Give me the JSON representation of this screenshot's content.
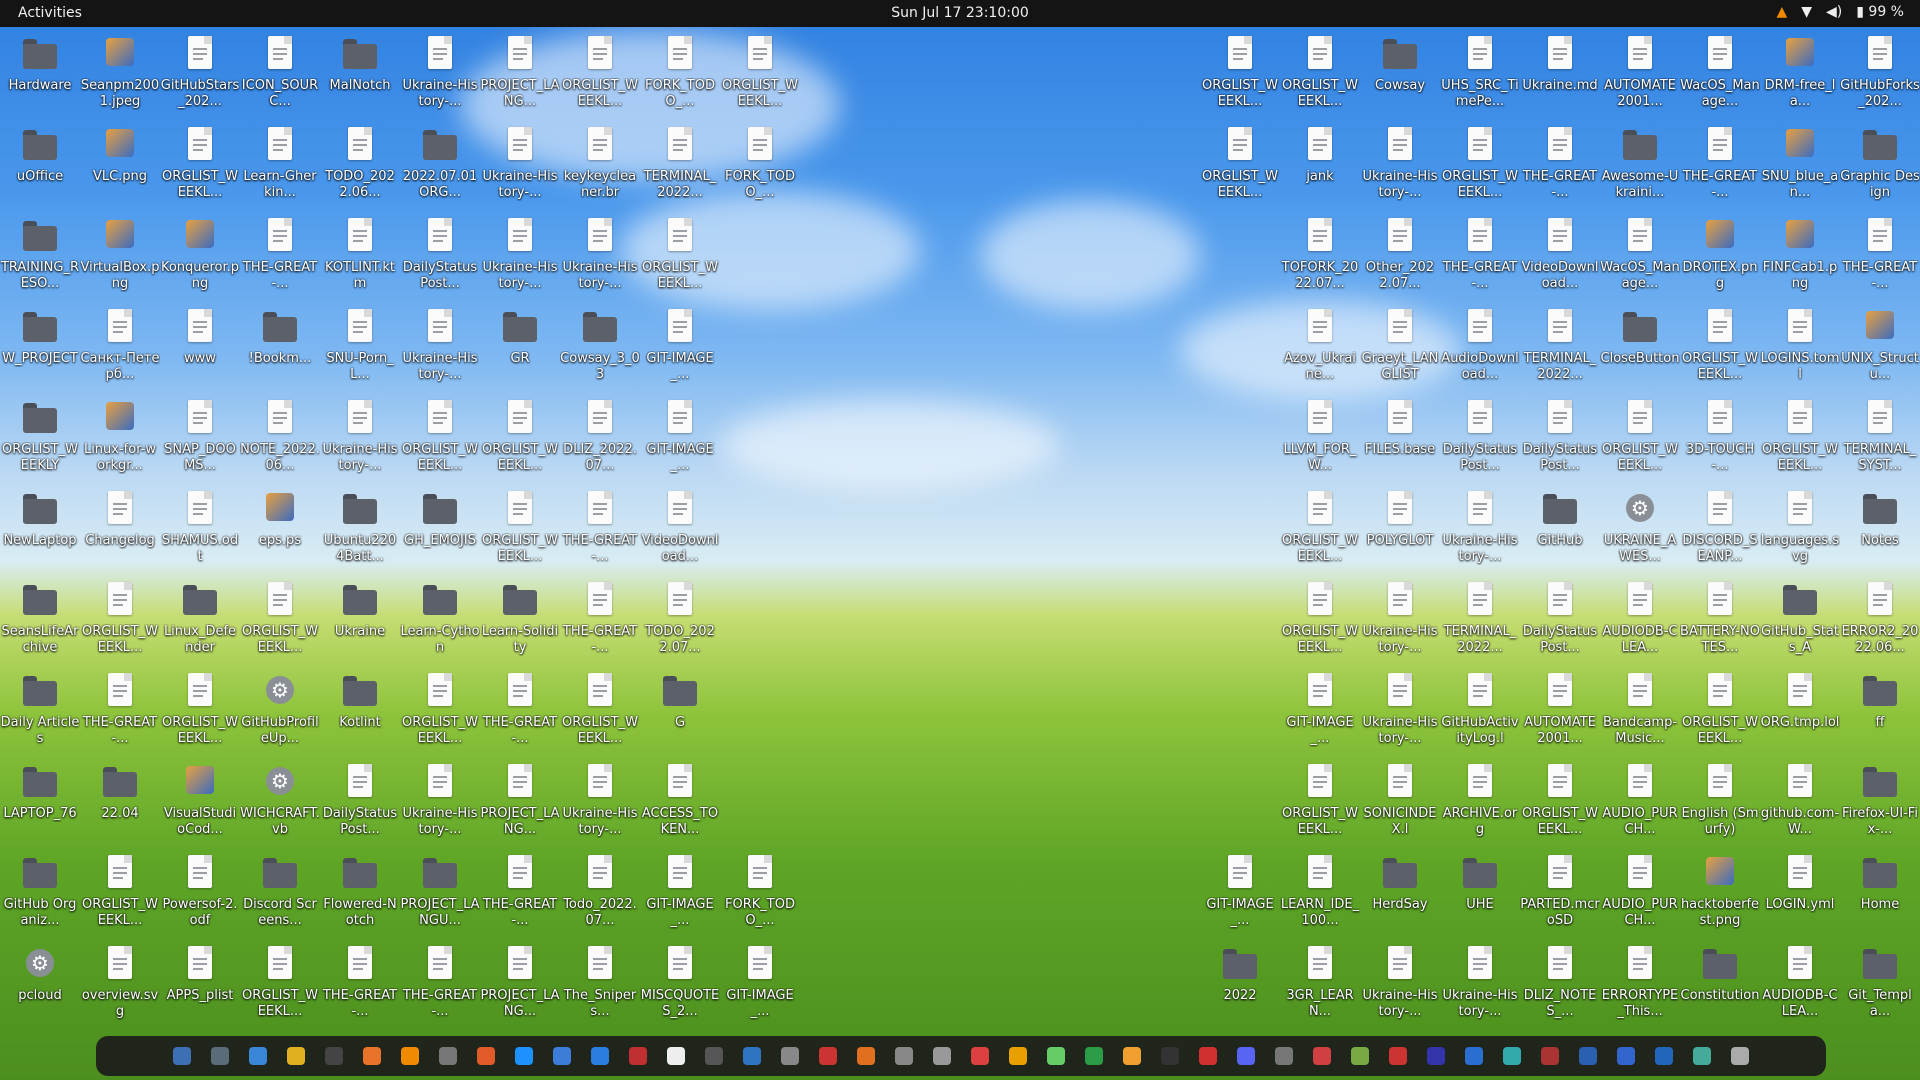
{
  "topbar": {
    "activities": "Activities",
    "clock": "Sun Jul 17  23:10:00",
    "tray": [
      {
        "icon": "vlc-cone-icon",
        "label": ""
      },
      {
        "icon": "wifi-icon",
        "label": ""
      },
      {
        "icon": "volume-icon",
        "label": ""
      },
      {
        "icon": "battery-icon",
        "label": "99 %"
      }
    ]
  },
  "desktop_left": [
    [
      "Hardware",
      "Seanpm2001.jpeg",
      "GitHubStars_202...",
      "ICON_SOURC...",
      "MalNotch",
      "Ukraine-History-...",
      "PROJECT_LANG...",
      "ORGLIST_WEEKL...",
      "FORK_TODO_...",
      "ORGLIST_WEEKL..."
    ],
    [
      "uOffice",
      "VLC.png",
      "ORGLIST_WEEKL...",
      "Learn-Gherkin...",
      "TODO_2022.06...",
      "2022.07.01ORG...",
      "Ukraine-History-...",
      "keykeycleaner.br",
      "TERMINAL_2022...",
      "FORK_TODO_..."
    ],
    [
      "TRAINING_RESO...",
      "VirtualBox.png",
      "Konqueror.png",
      "THE-GREAT-...",
      "KOTLINT.ktm",
      "DailyStatusPost...",
      "Ukraine-History-...",
      "Ukraine-History-...",
      "ORGLIST_WEEKL..."
    ],
    [
      "W_PROJECT",
      "Санкт-Петерб...",
      "www",
      "!Bookm...",
      "SNU-Porn_L...",
      "Ukraine-History-...",
      "GR",
      "Cowsay_3_03",
      "GIT-IMAGE_..."
    ],
    [
      "ORGLIST_WEEKLY",
      "Linux-for-workgr...",
      "SNAP_DOOMS...",
      "NOTE_2022.06...",
      "Ukraine-History-...",
      "ORGLIST_WEEKL...",
      "ORGLIST_WEEKL...",
      "DLIZ_2022.07...",
      "GIT-IMAGE_..."
    ],
    [
      "NewLaptop",
      "Changelog",
      "SHAMUS.odt",
      "eps.ps",
      "Ubuntu2204Batt...",
      "GH_EMOJIS",
      "ORGLIST_WEEKL...",
      "THE-GREAT-...",
      "VideoDownload..."
    ],
    [
      "SeansLifeArchive",
      "ORGLIST_WEEKL...",
      "Linux_Defender",
      "ORGLIST_WEEKL...",
      "Ukraine",
      "Learn-Cython",
      "Learn-Solidity",
      "THE-GREAT-...",
      "TODO_2022.07..."
    ],
    [
      "Daily Articles",
      "THE-GREAT-...",
      "ORGLIST_WEEKL...",
      "GitHubProfileUp...",
      "Kotlint",
      "ORGLIST_WEEKL...",
      "THE-GREAT-...",
      "ORGLIST_WEEKL...",
      "G"
    ],
    [
      "LAPTOP_76",
      "22.04",
      "VisualStudioCod...",
      "WICHCRAFT.vb",
      "DailyStatusPost...",
      "Ukraine-History-...",
      "PROJECT_LANG...",
      "Ukraine-History-...",
      "ACCESS_TOKEN..."
    ],
    [
      "GitHub Organiz...",
      "ORGLIST_WEEKL...",
      "Powersof-2.odf",
      "Discord Screens...",
      "Flowered-Notch",
      "PROJECT_LANGU...",
      "THE-GREAT-...",
      "Todo_2022.07...",
      "GIT-IMAGE_...",
      "FORK_TODO_..."
    ],
    [
      "pcloud",
      "overview.svg",
      "APPS_plist",
      "ORGLIST_WEEKL...",
      "THE-GREAT-...",
      "THE-GREAT-...",
      "PROJECT_LANG...",
      "The_Snipers...",
      "MISCQUOTES_2...",
      "GIT-IMAGE_..."
    ]
  ],
  "desktop_left_kinds": [
    [
      "folder",
      "img",
      "file",
      "file",
      "folder",
      "file",
      "file",
      "file",
      "file",
      "file"
    ],
    [
      "folder",
      "img",
      "file",
      "file",
      "file",
      "folder",
      "file",
      "file",
      "file",
      "file"
    ],
    [
      "folder",
      "img",
      "img",
      "file",
      "file",
      "file",
      "file",
      "file",
      "file"
    ],
    [
      "folder",
      "file",
      "file",
      "folder",
      "file",
      "file",
      "folder",
      "folder",
      "file"
    ],
    [
      "folder",
      "img",
      "file",
      "file",
      "file",
      "file",
      "file",
      "file",
      "file"
    ],
    [
      "folder",
      "file",
      "file",
      "img",
      "folder",
      "folder",
      "file",
      "file",
      "file"
    ],
    [
      "folder",
      "file",
      "folder",
      "file",
      "folder",
      "folder",
      "folder",
      "file",
      "file"
    ],
    [
      "folder",
      "file",
      "file",
      "gear",
      "folder",
      "file",
      "file",
      "file",
      "folder"
    ],
    [
      "folder",
      "folder",
      "img",
      "gear",
      "file",
      "file",
      "file",
      "file",
      "file"
    ],
    [
      "folder",
      "file",
      "file",
      "folder",
      "folder",
      "folder",
      "file",
      "file",
      "file",
      "file"
    ],
    [
      "gear",
      "file",
      "file",
      "file",
      "file",
      "file",
      "file",
      "file",
      "file",
      "file"
    ]
  ],
  "desktop_right": [
    [
      "ORGLIST_WEEKL...",
      "ORGLIST_WEEKL...",
      "Cowsay",
      "UHS_SRC_TimePe...",
      "Ukraine.md",
      "AUTOMATE2001...",
      "WacOS_Manage...",
      "DRM-free_la...",
      "GitHubForks_202..."
    ],
    [
      "ORGLIST_WEEKL...",
      "jank",
      "Ukraine-History-...",
      "ORGLIST_WEEKL...",
      "THE-GREAT-...",
      "Awesome-Ukraini...",
      "THE-GREAT-...",
      "SNU_blue_an...",
      "Graphic Design"
    ],
    [
      "TOFORK_2022.07...",
      "Other_2022.07...",
      "THE-GREAT-...",
      "VideoDownload...",
      "WacOS_Manage...",
      "DROTEX.png",
      "FINFCab1.png",
      "THE-GREAT-..."
    ],
    [
      "Azov_Ukraine...",
      "Graeyt_LANGLIST",
      "AudioDownload...",
      "TERMINAL_2022...",
      "CloseButton",
      "ORGLIST_WEEKL...",
      "LOGINS.toml",
      "UNIX_Structu..."
    ],
    [
      "LLVM_FOR_W...",
      "FILES.base",
      "DailyStatusPost...",
      "DailyStatusPost...",
      "ORGLIST_WEEKL...",
      "3D-TOUCH-...",
      "ORGLIST_WEEKL...",
      "TERMINAL_SYST..."
    ],
    [
      "ORGLIST_WEEKL...",
      "POLYGLOT",
      "Ukraine-History-...",
      "GitHub",
      "UKRAINE_AWES...",
      "DISCORD_SEANP...",
      "languages.svg",
      "Notes"
    ],
    [
      "ORGLIST_WEEKL...",
      "Ukraine-History-...",
      "TERMINAL_2022...",
      "DailyStatusPost...",
      "AUDIODB-CLEA...",
      "BATTERY-NOTES...",
      "GitHub_Stats_A",
      "ERROR2_2022.06..."
    ],
    [
      "GIT-IMAGE_...",
      "Ukraine-History-...",
      "GitHubActivityLog.l",
      "AUTOMATE2001...",
      "Bandcamp-Music...",
      "ORGLIST_WEEKL...",
      "ORG.tmp.lol",
      "ff"
    ],
    [
      "ORGLIST_WEEKL...",
      "SONICINDEX.l",
      "ARCHIVE.org",
      "ORGLIST_WEEKL...",
      "AUDIO_PURCH...",
      "English (Smurfy)",
      "github.com-W...",
      "Firefox-UI-Fix-..."
    ],
    [
      "GIT-IMAGE_...",
      "LEARN_IDE_100...",
      "HerdSay",
      "UHE",
      "PARTED.mcroSD",
      "AUDIO_PURCH...",
      "hacktoberfest.png",
      "LOGIN.yml",
      "Home"
    ],
    [
      "2022",
      "3GR_LEARN...",
      "Ukraine-History-...",
      "Ukraine-History-...",
      "DLIZ_NOTES_...",
      "ERRORTYPE_This...",
      "Constitution",
      "AUDIODB-CLEA...",
      "Git_Templa..."
    ]
  ],
  "desktop_right_kinds": [
    [
      "file",
      "file",
      "folder",
      "file",
      "file",
      "file",
      "file",
      "img",
      "file"
    ],
    [
      "file",
      "file",
      "file",
      "file",
      "file",
      "folder",
      "file",
      "img",
      "folder"
    ],
    [
      "file",
      "file",
      "file",
      "file",
      "file",
      "img",
      "img",
      "file"
    ],
    [
      "file",
      "file",
      "file",
      "file",
      "folder",
      "file",
      "file",
      "img"
    ],
    [
      "file",
      "file",
      "file",
      "file",
      "file",
      "file",
      "file",
      "file"
    ],
    [
      "file",
      "file",
      "file",
      "folder",
      "gear",
      "file",
      "file",
      "folder"
    ],
    [
      "file",
      "file",
      "file",
      "file",
      "file",
      "file",
      "folder",
      "file"
    ],
    [
      "file",
      "file",
      "file",
      "file",
      "file",
      "file",
      "file",
      "folder"
    ],
    [
      "file",
      "file",
      "file",
      "file",
      "file",
      "file",
      "file",
      "folder"
    ],
    [
      "file",
      "file",
      "folder",
      "folder",
      "file",
      "file",
      "img",
      "file",
      "folder"
    ],
    [
      "folder",
      "file",
      "file",
      "file",
      "file",
      "file",
      "folder",
      "file",
      "folder"
    ]
  ],
  "dock_colors": [
    "#3d6fb5",
    "#5a6b7a",
    "#3a86d6",
    "#e0b020",
    "#444",
    "#e8742a",
    "#f08a00",
    "#777",
    "#e05a2a",
    "#1e90ff",
    "#3c7dd9",
    "#2a7de1",
    "#c03030",
    "#eee",
    "#555",
    "#2f74c0",
    "#888",
    "#cc3333",
    "#e07020",
    "#888",
    "#999",
    "#dd4040",
    "#e8a000",
    "#6c6",
    "#2d9c46",
    "#f0a030",
    "#333",
    "#d03030",
    "#5865f2",
    "#777",
    "#d04040",
    "#7a4",
    "#c33",
    "#33a",
    "#2a6fd0",
    "#3aa",
    "#a33",
    "#2b5fb0",
    "#3366cc",
    "#2266bb",
    "#4a9",
    "#aaa"
  ]
}
